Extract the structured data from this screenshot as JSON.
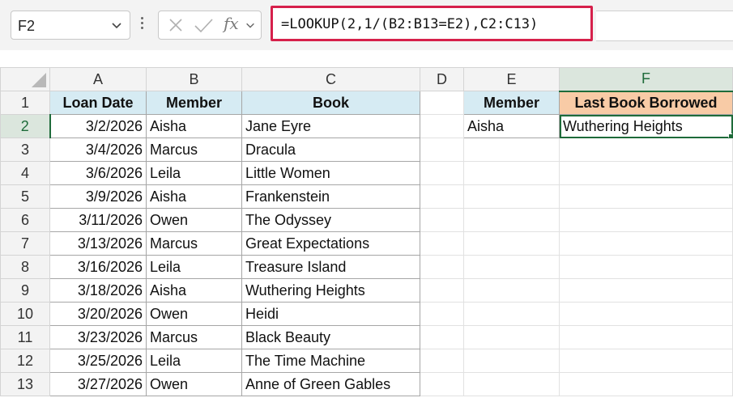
{
  "name_box": {
    "value": "F2"
  },
  "formula_bar": {
    "formula": "=LOOKUP(2,1/(B2:B13=E2),C2:C13)"
  },
  "columns": [
    "A",
    "B",
    "C",
    "D",
    "E",
    "F"
  ],
  "rows": [
    "1",
    "2",
    "3",
    "4",
    "5",
    "6",
    "7",
    "8",
    "9",
    "10",
    "11",
    "12",
    "13"
  ],
  "headers": {
    "loan_date": "Loan Date",
    "member": "Member",
    "book": "Book"
  },
  "loans": [
    {
      "date": "3/2/2026",
      "member": "Aisha",
      "book": "Jane Eyre"
    },
    {
      "date": "3/4/2026",
      "member": "Marcus",
      "book": "Dracula"
    },
    {
      "date": "3/6/2026",
      "member": "Leila",
      "book": "Little Women"
    },
    {
      "date": "3/9/2026",
      "member": "Aisha",
      "book": "Frankenstein"
    },
    {
      "date": "3/11/2026",
      "member": "Owen",
      "book": "The Odyssey"
    },
    {
      "date": "3/13/2026",
      "member": "Marcus",
      "book": "Great Expectations"
    },
    {
      "date": "3/16/2026",
      "member": "Leila",
      "book": "Treasure Island"
    },
    {
      "date": "3/18/2026",
      "member": "Aisha",
      "book": "Wuthering Heights"
    },
    {
      "date": "3/20/2026",
      "member": "Owen",
      "book": "Heidi"
    },
    {
      "date": "3/23/2026",
      "member": "Marcus",
      "book": "Black Beauty"
    },
    {
      "date": "3/25/2026",
      "member": "Leila",
      "book": "The Time Machine"
    },
    {
      "date": "3/27/2026",
      "member": "Owen",
      "book": "Anne of Green Gables"
    }
  ],
  "lookup": {
    "member_header": "Member",
    "result_header": "Last Book Borrowed",
    "member_value": "Aisha",
    "result_value": "Wuthering Heights"
  },
  "colors": {
    "accent": "#1e6b3a",
    "highlight_border": "#d6204b",
    "header_blue": "#d6ebf3",
    "header_orange": "#f8cba6"
  },
  "icons": [
    "chevron-down-icon",
    "cancel-x-icon",
    "enter-check-icon",
    "insert-function-icon"
  ]
}
